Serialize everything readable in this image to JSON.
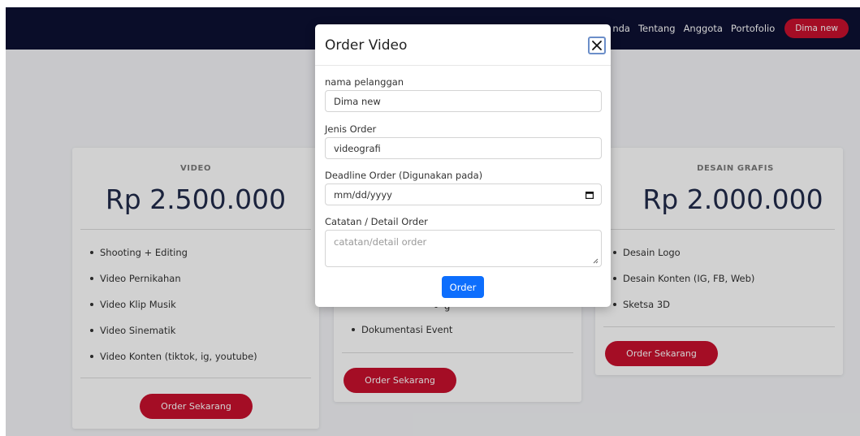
{
  "navbar": {
    "links": [
      "nda",
      "Tentang",
      "Anggota",
      "Portofolio"
    ],
    "user_button": "Dima new"
  },
  "cards": [
    {
      "heading": "VIDEO",
      "price": "Rp 2.500.000",
      "items": [
        "Shooting + Editing",
        "Video Pernikahan",
        "Video Klip Musik",
        "Video Sinematik",
        "Video Konten (tiktok, ig, youtube)"
      ],
      "button": "Order Sekarang"
    },
    {
      "items_visible": [
        "g",
        "Dokumentasi Event"
      ],
      "button": "Order Sekarang"
    },
    {
      "heading": "DESAIN GRAFIS",
      "price": "Rp 2.000.000",
      "items": [
        "Desain Logo",
        "Desain Konten (IG, FB, Web)",
        "Sketsa 3D"
      ],
      "button": "Order Sekarang"
    }
  ],
  "modal": {
    "title": "Order Video",
    "fields": {
      "customer_label": "nama pelanggan",
      "customer_value": "Dima new",
      "type_label": "Jenis Order",
      "type_value": "videografi",
      "deadline_label": "Deadline Order (Digunakan pada)",
      "deadline_placeholder": "mm/dd/yyyy",
      "notes_label": "Catatan / Detail Order",
      "notes_placeholder": "catatan/detail order"
    },
    "submit_label": "Order"
  },
  "colors": {
    "navbar": "#0d1132",
    "accent_red": "#c8102e",
    "primary_blue": "#0d6efd",
    "price_text": "#212b4b"
  },
  "icons": {
    "close": "close-icon",
    "calendar": "calendar-icon",
    "resize": "resize-grip-icon"
  }
}
